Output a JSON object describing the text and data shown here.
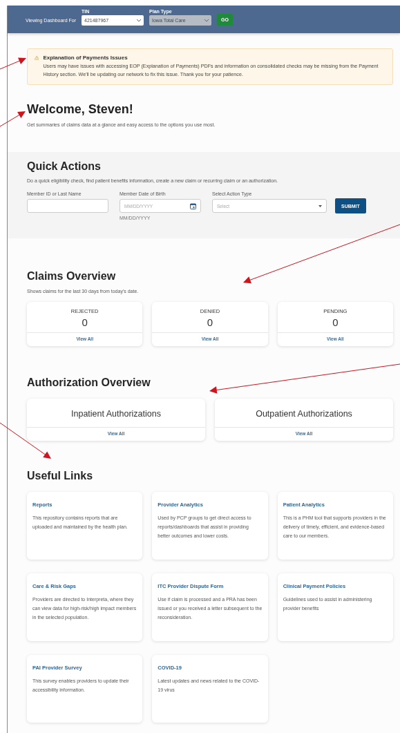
{
  "header": {
    "label": "Viewing Dashboard For",
    "fields": [
      {
        "label": "TIN",
        "value": "421487967",
        "disabled": false
      },
      {
        "label": "Plan Type",
        "value": "Iowa Total Care",
        "disabled": true
      }
    ],
    "go_button": "GO"
  },
  "alert": {
    "title": "Explanation of Payments Issues",
    "message": "Users may have issues with accessing EOP (Explanation of Payments) PDFs and information on consolidated checks may be missing from the Payment History section. We'll be updating our network to fix this issue.  Thank you for your patience."
  },
  "welcome": {
    "title": "Welcome, Steven!",
    "subtitle": "Get summaries of claims data at a glance and easy access to the options you use most."
  },
  "quick_actions": {
    "title": "Quick Actions",
    "description": "Do a quick eligibility check, find patient benefits information, create a new claim or recurring claim or an authorization.",
    "fields": [
      {
        "kind": "text",
        "label": "Member ID or Last Name"
      },
      {
        "kind": "date",
        "label": "Member Date of Birth",
        "placeholder": "MM/DD/YYYY",
        "helper": "MM/DD/YYYY"
      },
      {
        "kind": "select",
        "label": "Select Action Type",
        "placeholder": "Select"
      }
    ],
    "submit": "SUBMIT"
  },
  "claims_overview": {
    "title": "Claims Overview",
    "subtitle": "Shows claims for the last 30 days from today's date.",
    "cards": [
      {
        "label": "REJECTED",
        "count": "0",
        "link": "View All"
      },
      {
        "label": "DENIED",
        "count": "0",
        "link": "View All"
      },
      {
        "label": "PENDING",
        "count": "0",
        "link": "View All"
      }
    ]
  },
  "authorization_overview": {
    "title": "Authorization Overview",
    "cards": [
      {
        "label": "Inpatient Authorizations",
        "link": "View All"
      },
      {
        "label": "Outpatient Authorizations",
        "link": "View All"
      }
    ]
  },
  "useful_links": {
    "title": "Useful Links",
    "items": [
      {
        "title": "Reports",
        "description": "This repository contains reports that are uploaded and maintained by the health plan."
      },
      {
        "title": "Provider Analytics",
        "description": "Used by PCP groups to get direct access to reports/dashboards that assist in providing better outcomes and lower costs."
      },
      {
        "title": "Patient Analytics",
        "description": "This is a PHM tool that supports providers in the delivery of timely, efficient, and evidence-based care to our members."
      },
      {
        "title": "Care & Risk Gaps",
        "description": "Providers are directed to Interpreta, where they can view data for high-risk/high impact members in the selected population."
      },
      {
        "title": "ITC Provider Dispute Form",
        "description": "Use if claim is processed and a PRA has been issued or you received a letter subsequent to the reconsideration."
      },
      {
        "title": "Clinical Payment Policies",
        "description": "Guidelines used to assist in administering provider benefits"
      },
      {
        "title": "PAI Provider Survey",
        "description": "This survey enables providers to update their accessibility information."
      },
      {
        "title": "COVID-19",
        "description": "Latest updates and news related to the COVID-19 virus"
      }
    ]
  }
}
